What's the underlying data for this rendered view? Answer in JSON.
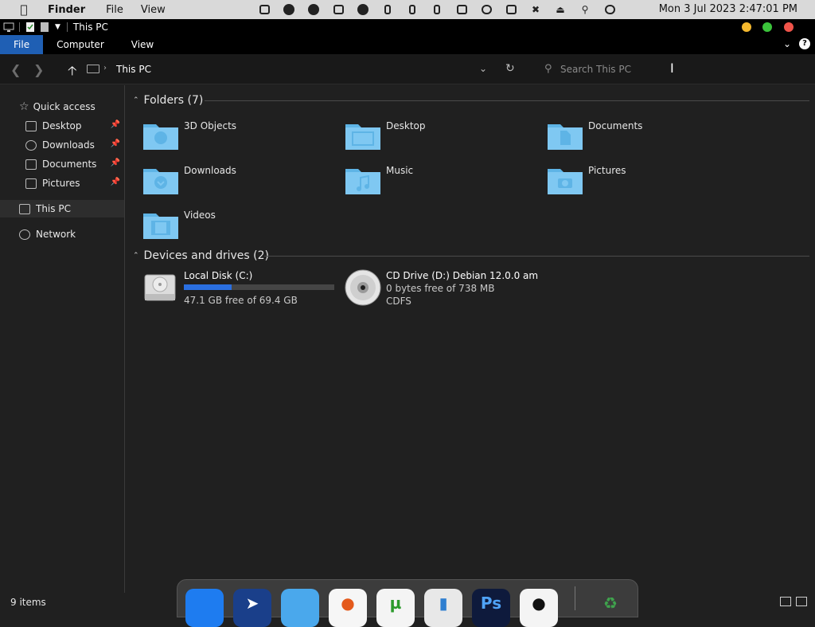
{
  "menubar": {
    "apple": "",
    "app_name": "Finder",
    "menus": [
      "File",
      "View"
    ],
    "clock": "Mon 3 Jul 2023  2:47:01 PM"
  },
  "window": {
    "title": "This PC"
  },
  "ribbon": {
    "tabs": [
      "File",
      "Computer",
      "View"
    ],
    "help_label": "?"
  },
  "address": {
    "crumb": "This PC",
    "search_placeholder": "Search This PC"
  },
  "nav": {
    "quick_access": "Quick access",
    "quick_items": [
      "Desktop",
      "Downloads",
      "Documents",
      "Pictures"
    ],
    "this_pc": "This PC",
    "network": "Network"
  },
  "folders": {
    "header": "Folders (7)",
    "items": [
      "3D Objects",
      "Desktop",
      "Documents",
      "Downloads",
      "Music",
      "Pictures",
      "Videos"
    ]
  },
  "devices": {
    "header": "Devices and drives (2)",
    "local": {
      "name": "Local Disk (C:)",
      "free": "47.1 GB free of 69.4 GB",
      "used_fraction": 0.32
    },
    "cd": {
      "name": "CD Drive (D:) Debian 12.0.0 am",
      "free": "0 bytes free of 738 MB",
      "fs": "CDFS"
    }
  },
  "status": {
    "count": "9 items"
  },
  "dock": {
    "ps_label": "Ps"
  },
  "colors": {
    "accent": "#1f5fb4",
    "folder": "#7fc8f2",
    "drive_bar": "#2a6fe0"
  }
}
